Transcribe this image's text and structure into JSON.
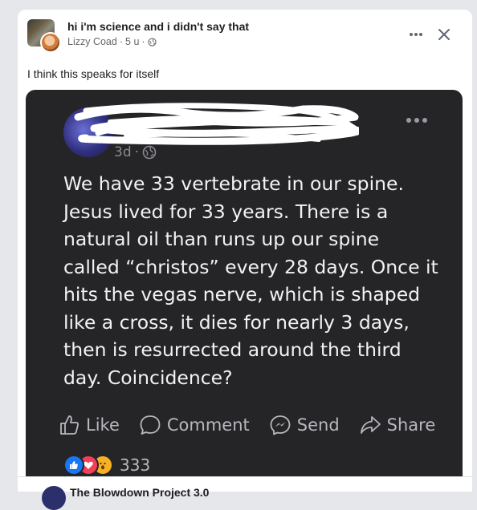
{
  "post": {
    "group_name": "hi i'm science and i didn't say that",
    "author": "Lizzy Coad",
    "time": "5 u",
    "caption": "I think this speaks for itself",
    "icons": {
      "more": "more-icon",
      "close": "close-icon",
      "privacy": "globe-icon"
    }
  },
  "shared_post": {
    "time": "3d",
    "text": "We have 33 vertebrate in our spine.\nJesus lived for 33 years.  There is a natural oil than runs up our spine called “christos” every 28 days.  Once it hits the vegas nerve, which is shaped like a cross, it dies for nearly 3 days, then is resurrected around the third day.  Coincidence?",
    "actions": {
      "like": "Like",
      "comment": "Comment",
      "send": "Send",
      "share": "Share"
    },
    "reaction_count": "333",
    "reactions": [
      "like",
      "love",
      "wow"
    ]
  },
  "next_post": {
    "title": "The Blowdown Project 3.0"
  },
  "colors": {
    "card_bg": "#ffffff",
    "shared_bg": "#252528",
    "like_blue": "#1877f2",
    "love_red": "#f33e58",
    "wow_yellow": "#f7b125"
  }
}
